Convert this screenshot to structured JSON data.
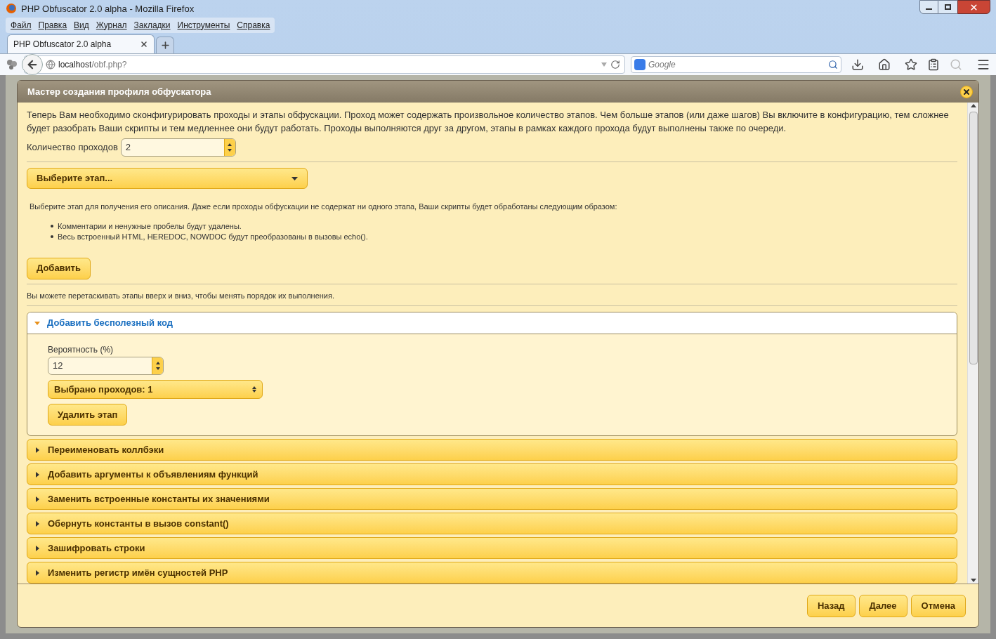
{
  "window": {
    "title": "PHP Obfuscator 2.0 alpha - Mozilla Firefox"
  },
  "menu": [
    "Файл",
    "Правка",
    "Вид",
    "Журнал",
    "Закладки",
    "Инструменты",
    "Справка"
  ],
  "tabs": [
    {
      "label": "PHP Obfuscator 2.0 alpha",
      "selected": true
    }
  ],
  "address": {
    "host": "localhost",
    "path": "/obf.php?"
  },
  "search": {
    "placeholder": "Google"
  },
  "dialog": {
    "title": "Мастер создания профиля обфускатора",
    "intro": "Теперь Вам необходимо сконфигурировать проходы и этапы обфускации. Проход может содержать произвольное количество этапов. Чем больше этапов (или даже шагов) Вы включите в конфигурацию, тем сложнее будет разобрать Ваши скрипты и тем медленнее они будут работать. Проходы выполняются друг за другом, этапы в рамках каждого прохода будут выполнены также по очереди.",
    "passes_label": "Количество проходов",
    "passes_value": "2",
    "stage_select": "Выберите этап...",
    "stage_note": "Выберите этап для получения его описания. Даже если проходы обфускации не содержат ни одного этапа, Ваши скрипты будет обработаны следующим образом:",
    "bullets": [
      "Комментарии и ненужные пробелы будут удалены.",
      "Весь встроенный HTML, HEREDOC, NOWDOC будут преобразованы в вызовы echo()."
    ],
    "add_button": "Добавить",
    "drag_note": "Вы можете перетаскивать этапы вверх и вниз, чтобы менять порядок их выполнения.",
    "stages": [
      {
        "title": "Добавить бесполезный код",
        "expanded": true,
        "probability_label": "Вероятность (%)",
        "probability_value": "12",
        "passes_select": "Выбрано проходов: 1",
        "remove_button": "Удалить этап"
      },
      {
        "title": "Переименовать коллбэки",
        "expanded": false
      },
      {
        "title": "Добавить аргументы к объявлениям функций",
        "expanded": false
      },
      {
        "title": "Заменить встроенные константы их значениями",
        "expanded": false
      },
      {
        "title": "Обернуть константы в вызов constant()",
        "expanded": false
      },
      {
        "title": "Зашифровать строки",
        "expanded": false
      },
      {
        "title": "Изменить регистр имён сущностей PHP",
        "expanded": false
      }
    ],
    "buttons": [
      "Назад",
      "Далее",
      "Отмена"
    ]
  }
}
